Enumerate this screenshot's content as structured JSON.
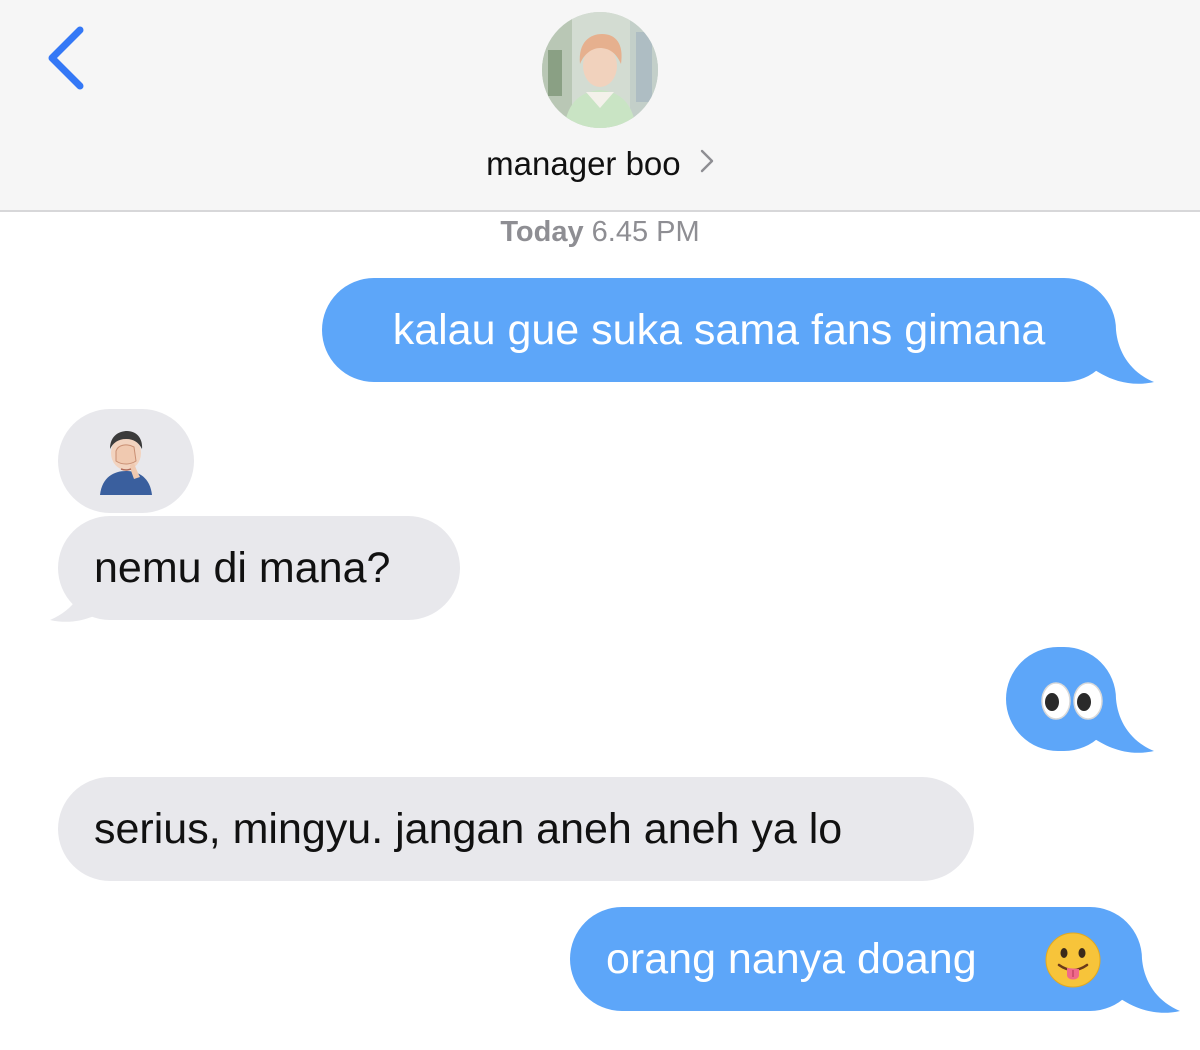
{
  "header": {
    "contact_name": "manager boo"
  },
  "thread": {
    "timestamp_day": "Today",
    "timestamp_time": "6.45 PM"
  },
  "messages": [
    {
      "direction": "outgoing",
      "text": "kalau gue suka sama fans gimana"
    },
    {
      "direction": "incoming",
      "kind": "emoji",
      "emoji": "man-facepalming"
    },
    {
      "direction": "incoming",
      "text": "nemu di mana?"
    },
    {
      "direction": "outgoing",
      "kind": "emoji",
      "emoji": "eyes"
    },
    {
      "direction": "incoming",
      "text": "serius, mingyu. jangan aneh aneh ya lo"
    },
    {
      "direction": "outgoing",
      "text": "orang nanya doang",
      "emoji": "face-with-tongue"
    }
  ],
  "colors": {
    "outgoing_bubble": "#5da6f9",
    "incoming_bubble": "#e8e8ec",
    "accent": "#3478f6",
    "header_bg": "#f6f6f6"
  }
}
